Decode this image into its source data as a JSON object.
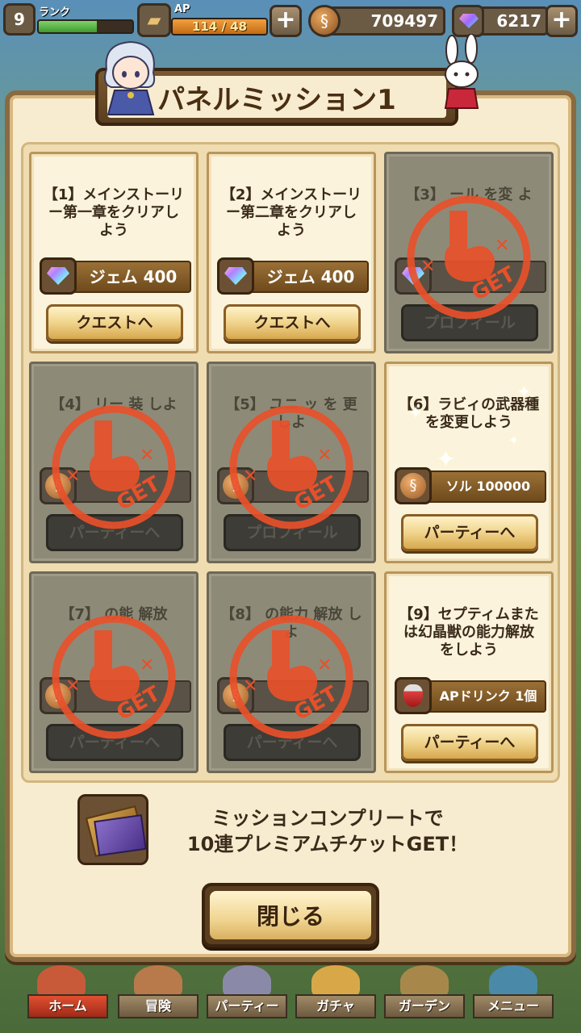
{
  "status": {
    "rank_value": "9",
    "rank_label": "ランク",
    "rank_progress": 0.62,
    "ap_label": "AP",
    "ap_value": "114 / 48",
    "ap_progress": 1.0,
    "sol": "709497",
    "gems": "6217"
  },
  "panel": {
    "title": "パネルミッション1"
  },
  "missions": [
    {
      "id": 1,
      "title": "【1】メインストーリー第一章をクリアしよう",
      "reward": "ジェム 400",
      "reward_icon": "gem-icon",
      "button": "クエストへ",
      "completed": false
    },
    {
      "id": 2,
      "title": "【2】メインストーリー第二章をクリアしよう",
      "reward": "ジェム 400",
      "reward_icon": "gem-icon",
      "button": "クエストへ",
      "completed": false
    },
    {
      "id": 3,
      "title": "【3】 ール を変 よ",
      "reward": "",
      "reward_icon": "gem-icon",
      "button": "プロフィール",
      "completed": true
    },
    {
      "id": 4,
      "title": "【4】 リー 装 しよ",
      "reward": "",
      "reward_icon": "coin-icon",
      "button": "パーティーへ",
      "completed": true
    },
    {
      "id": 5,
      "title": "【5】 ユニ ッ を 更しよ",
      "reward": "",
      "reward_icon": "coin-icon",
      "button": "プロフィール",
      "completed": true
    },
    {
      "id": 6,
      "title": "【6】ラビィの武器種を変更しよう",
      "reward": "ソル 100000",
      "reward_icon": "coin-icon",
      "button": "パーティーへ",
      "completed": false
    },
    {
      "id": 7,
      "title": "【7】 の能 解放",
      "reward": "",
      "reward_icon": "coin-icon",
      "button": "パーティーへ",
      "completed": true
    },
    {
      "id": 8,
      "title": "【8】 の能力 解放 しよ",
      "reward": "",
      "reward_icon": "coin-icon",
      "button": "パーティーへ",
      "completed": true
    },
    {
      "id": 9,
      "title": "【9】セプティムまたは幻晶獣の能力解放をしよう",
      "reward": "APドリンク 1個",
      "reward_icon": "potion-icon",
      "button": "パーティーへ",
      "completed": false
    }
  ],
  "stamp_text": "GET",
  "complete": {
    "line1": "ミッションコンプリートで",
    "line2": "10連プレミアムチケットGET！"
  },
  "close_label": "閉じる",
  "nav": [
    {
      "label": "ホーム",
      "active": true
    },
    {
      "label": "冒険",
      "active": false
    },
    {
      "label": "パーティー",
      "active": false
    },
    {
      "label": "ガチャ",
      "active": false
    },
    {
      "label": "ガーデン",
      "active": false
    },
    {
      "label": "メニュー",
      "active": false
    }
  ],
  "colors": {
    "panel_bg": "#f8ecd0",
    "stamp": "#e8502a",
    "button_gold": "#f0d48c"
  }
}
